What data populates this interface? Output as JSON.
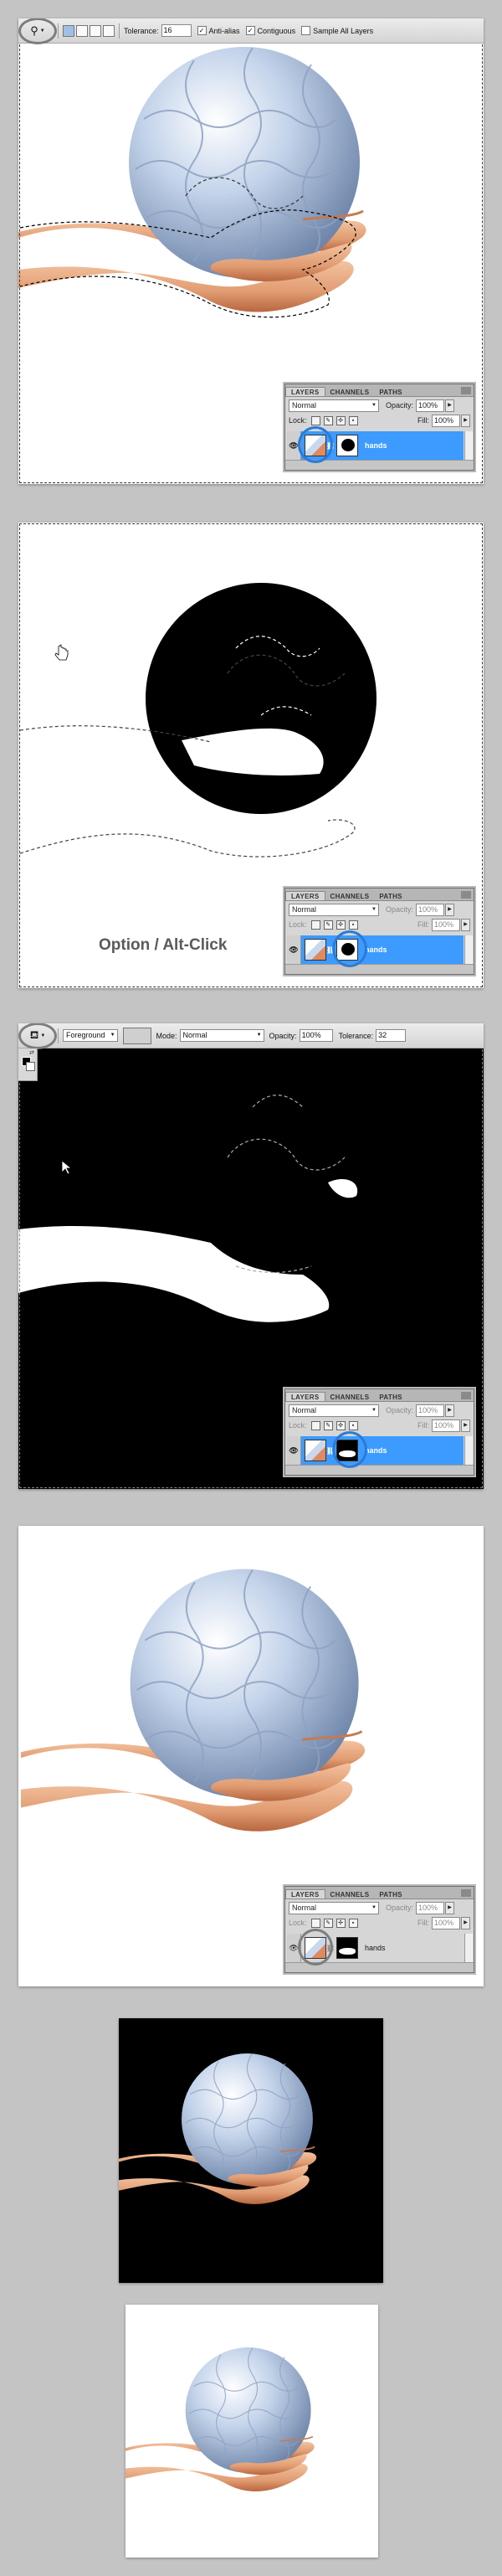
{
  "step1": {
    "toolbar": {
      "tolerance_label": "Tolerance:",
      "tolerance_value": "16",
      "antialias_label": "Anti-alias",
      "contiguous_label": "Contiguous",
      "sample_label": "Sample All Layers"
    },
    "panel": {
      "tabs": [
        "LAYERS",
        "CHANNELS",
        "PATHS"
      ],
      "blend_mode": "Normal",
      "opacity_label": "Opacity:",
      "opacity_value": "100%",
      "lock_label": "Lock:",
      "fill_label": "Fill:",
      "fill_value": "100%",
      "layer_name": "hands"
    }
  },
  "step2": {
    "caption": "Option / Alt-Click",
    "panel": {
      "tabs": [
        "LAYERS",
        "CHANNELS",
        "PATHS"
      ],
      "blend_mode": "Normal",
      "opacity_label": "Opacity:",
      "opacity_value": "100%",
      "lock_label": "Lock:",
      "fill_label": "Fill:",
      "fill_value": "100%",
      "layer_name": "hands"
    }
  },
  "step3": {
    "toolbar": {
      "fill_source": "Foreground",
      "mode_label": "Mode:",
      "mode_value": "Normal",
      "opacity_label": "Opacity:",
      "opacity_value": "100%",
      "tolerance_label": "Tolerance:",
      "tolerance_value": "32"
    },
    "panel": {
      "tabs": [
        "LAYERS",
        "CHANNELS",
        "PATHS"
      ],
      "blend_mode": "Normal",
      "opacity_label": "Opacity:",
      "opacity_value": "100%",
      "lock_label": "Lock:",
      "fill_label": "Fill:",
      "fill_value": "100%",
      "layer_name": "hands"
    }
  },
  "step4": {
    "panel": {
      "tabs": [
        "LAYERS",
        "CHANNELS",
        "PATHS"
      ],
      "blend_mode": "Normal",
      "opacity_label": "Opacity:",
      "opacity_value": "100%",
      "lock_label": "Lock:",
      "fill_label": "Fill:",
      "fill_value": "100%",
      "layer_name": "hands"
    }
  },
  "colors": {
    "page_bg": "#c4c4c4",
    "layer_selected": "#3d9bff",
    "highlight_gray": "#7d7d7d",
    "highlight_blue": "#2a7bd8",
    "sphere": "#b9cce6",
    "skin": "#e7a57c"
  },
  "icons": [
    "magic-wand-icon",
    "paint-bucket-icon",
    "eye-icon",
    "chain-link-icon",
    "lock-icon",
    "brush-icon",
    "move-icon",
    "hand-cursor-icon",
    "arrow-cursor-icon"
  ]
}
